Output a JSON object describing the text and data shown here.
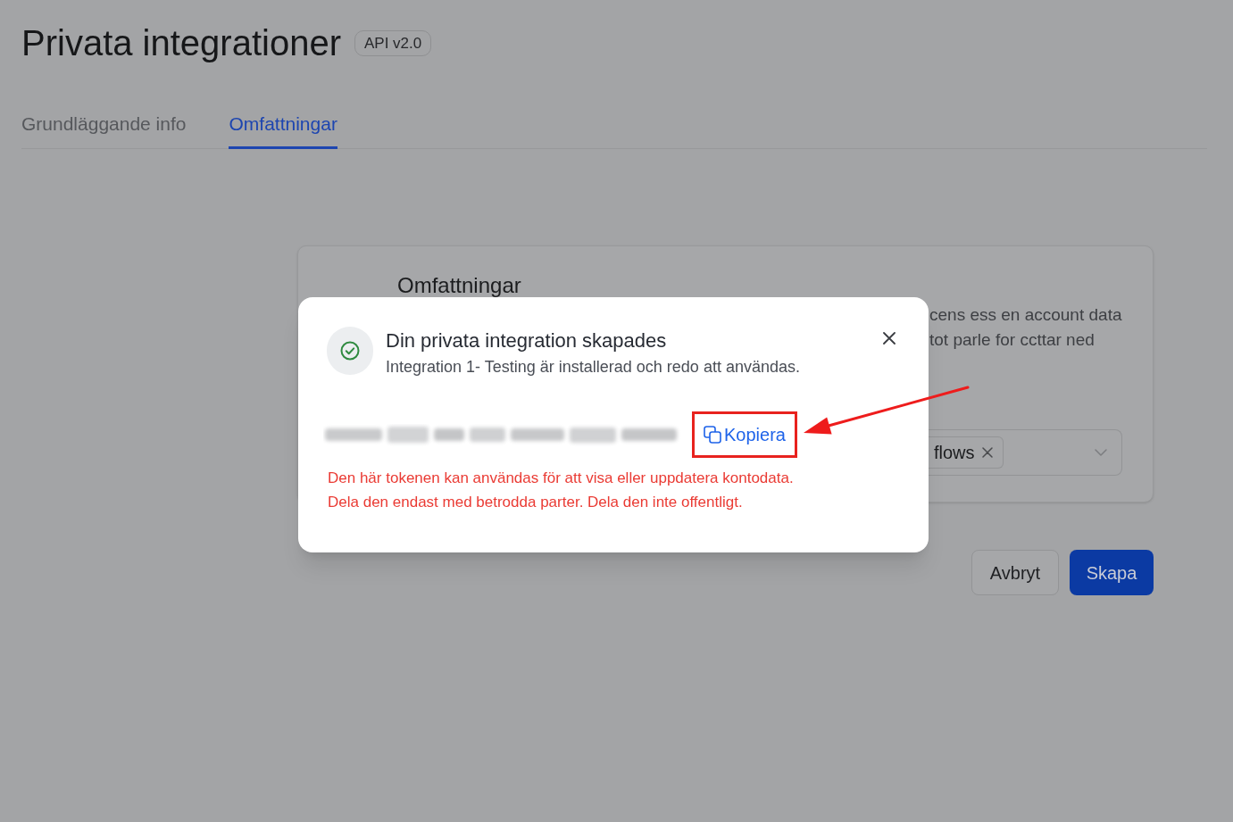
{
  "page": {
    "title": "Privata integrationer",
    "badge": "API v2.0"
  },
  "tabs": [
    {
      "label": "Grundläggande info",
      "selected": false
    },
    {
      "label": "Omfattningar",
      "selected": true
    }
  ],
  "scopes_card": {
    "heading": "Omfattningar",
    "description_lines": [
      "cens ess en account data",
      "tot parle for ccttar ned"
    ],
    "select": {
      "chips": [
        {
          "label": "flows"
        }
      ]
    }
  },
  "actions": [
    {
      "label": "Avbryt",
      "kind": "secondary"
    },
    {
      "label": "Skapa",
      "kind": "primary"
    }
  ],
  "dialog": {
    "title": "Din privata integration skapades",
    "message": "Integration 1- Testing är installerad och redo att användas.",
    "copy_button": "Kopiera",
    "warning_lines": [
      "Den här tokenen kan användas för att visa eller uppdatera kontodata.",
      "Dela den endast med betrodda parter. Dela den inte offentligt."
    ]
  }
}
